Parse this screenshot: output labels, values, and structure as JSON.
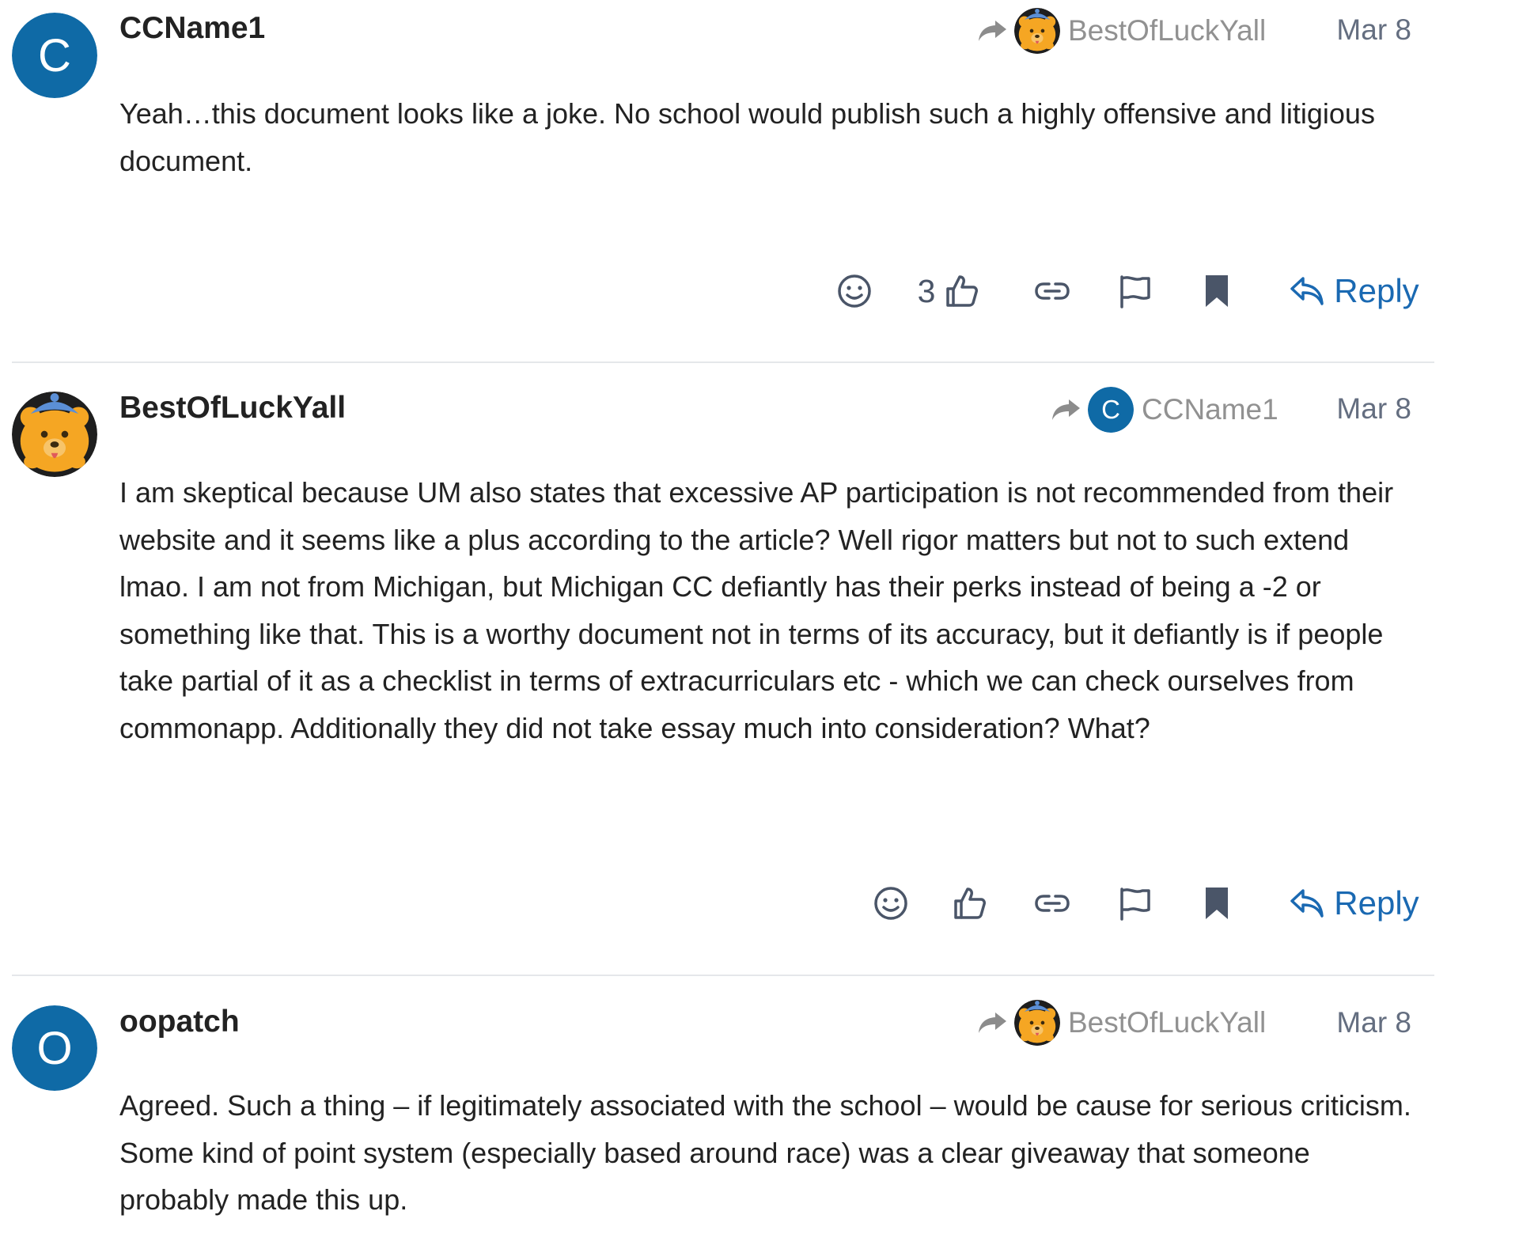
{
  "colors": {
    "avatar_blue": "#0f6aa6",
    "link_blue": "#1a69b2",
    "action_gray": "#4a5568",
    "muted_text": "#919191",
    "date_text": "#646e80",
    "bear_orange": "#f5a623"
  },
  "posts": [
    {
      "username": "CCName1",
      "avatar_letter": "C",
      "reply_to": {
        "username": "BestOfLuckYall",
        "avatar": "bear-avatar"
      },
      "date": "Mar 8",
      "body": "Yeah…this document looks like a joke. No school would publish such a highly offensive and litigious document.",
      "like_count": "3",
      "reply_label": "Reply"
    },
    {
      "username": "BestOfLuckYall",
      "avatar": "bear-avatar",
      "reply_to": {
        "username": "CCName1",
        "avatar_letter": "C"
      },
      "date": "Mar 8",
      "body": "I am skeptical because UM also states that excessive AP participation is not recommended from their website and it seems like a plus according to the article? Well rigor matters but not to such extend lmao. I am not from Michigan, but Michigan CC defiantly has their perks instead of being a -2 or something like that. This is a worthy document not in terms of its accuracy, but it defiantly is if people take partial of it as a checklist in terms of extracurriculars etc - which we can check ourselves from commonapp. Additionally they did not take essay much into consideration? What?",
      "like_count": "",
      "reply_label": "Reply"
    },
    {
      "username": "oopatch",
      "avatar_letter": "O",
      "reply_to": {
        "username": "BestOfLuckYall",
        "avatar": "bear-avatar"
      },
      "date": "Mar 8",
      "body": "Agreed. Such a thing – if legitimately associated with the school – would be cause for serious criticism. Some kind of point system (especially based around race) was a clear giveaway that someone probably made this up."
    }
  ],
  "icons": {
    "reaction": "smiley-icon",
    "like": "thumbs-up-icon",
    "copy_link": "link-icon",
    "flag": "flag-icon",
    "bookmark": "bookmark-icon",
    "reply": "reply-arrow-icon",
    "replied_to": "share-arrow-icon"
  }
}
